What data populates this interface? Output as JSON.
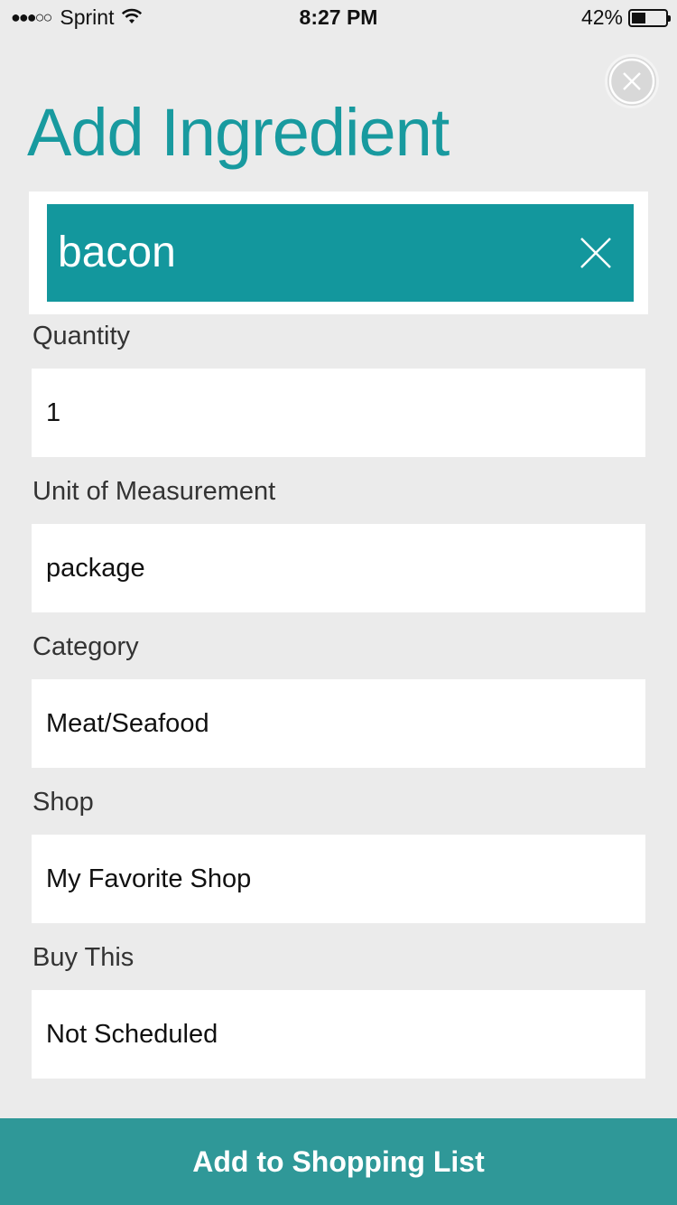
{
  "status_bar": {
    "signal": "●●●○○",
    "carrier": "Sprint",
    "wifi_icon": "wifi-icon",
    "time": "8:27 PM",
    "battery_percent": "42%",
    "battery_level": 0.42
  },
  "header": {
    "title": "Add Ingredient",
    "close_icon": "close-circle-icon"
  },
  "search": {
    "value": "bacon",
    "clear_icon": "close-icon"
  },
  "fields": {
    "quantity": {
      "label": "Quantity",
      "value": "1"
    },
    "unit": {
      "label": "Unit of Measurement",
      "value": "package"
    },
    "category": {
      "label": "Category",
      "value": "Meat/Seafood"
    },
    "shop": {
      "label": "Shop",
      "value": "My Favorite Shop"
    },
    "buy_this": {
      "label": "Buy This",
      "value": "Not Scheduled"
    }
  },
  "footer": {
    "add_button_label": "Add to Shopping List"
  },
  "colors": {
    "accent": "#189a9f",
    "search_bg": "#13979d",
    "button_bg": "#2f9898",
    "page_bg": "#ebebeb"
  }
}
